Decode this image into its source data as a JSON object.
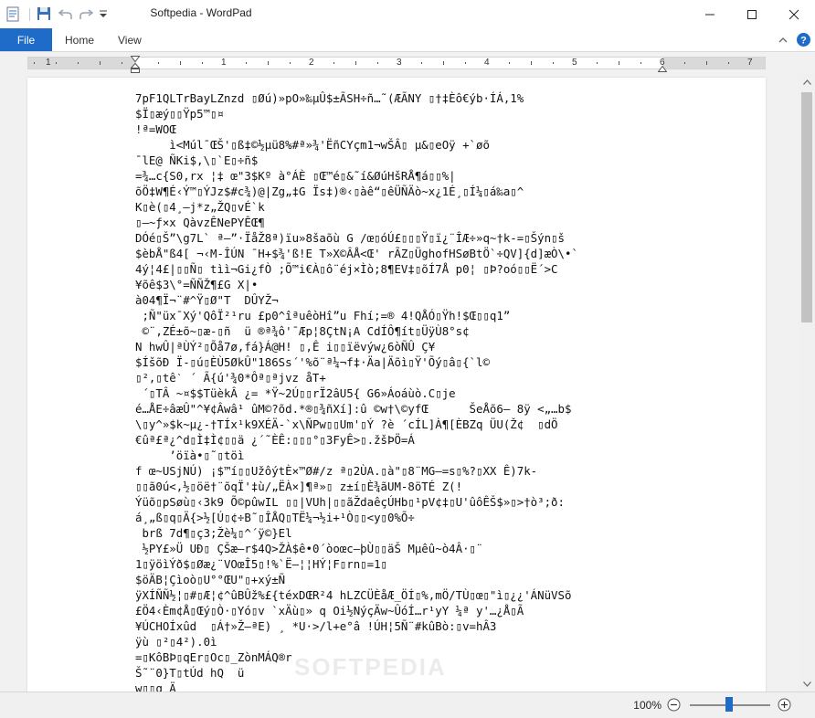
{
  "window": {
    "title": "Softpedia - WordPad",
    "minimize_symbol": "—",
    "maximize_symbol": "☐",
    "close_symbol": "✕"
  },
  "ribbon": {
    "tabs": [
      {
        "label": "File"
      },
      {
        "label": "Home"
      },
      {
        "label": "View"
      }
    ]
  },
  "ruler": {
    "numbers": [
      "1",
      "1",
      "2",
      "3",
      "4",
      "5",
      "6",
      "7"
    ]
  },
  "document": {
    "lines": [
      "7pF1QLTrBayLZnzd ▯Øú)»pO»‰µÛ$±ÃSH÷ñ…˜(ÆÃNY ▯†‡Èô€ýb·ÍÁ,1%",
      "$Ï▯æý▯▯Ÿp5™▯¤",
      "!ª=WOŒ",
      "     ì<Múl¯ŒŠ'▯ß‡©½µü8%#ª»¾'ËñCYçm1¬wŠÂ▯ µ&▯eOÿ +`øõ",
      "¯lE@ ÑKi$,\\▯`E▯÷ñ$",
      "=¾…c{S0,rx ¦‡ œ\"3$Kº à°ÁÈ ▯Œ™é▯&˜í&ØúHšRÅ¶á▯▯%|",
      "õÖ‡W¶É‹Ý™▯ÝJz$#c¾)@|Zg„‡G Ïs‡)®‹▯àê“▯êÜÑÄò~x¿1É¸▯Í¼▯á‰a▯^",
      "K▯è(▯4¸–j*z„ŽQ▯vÉ`k",
      "▯–~ƒ×x QàvzÊNePYÊŒ¶",
      "DÓé▯Š”\\g7L` ª–”·ÏåŽ8ª)ïu»8šaõù G /œ▯óÚ£▯▯▯Ÿ▯ï¿¨ÎÆ÷»q~†k-=▯Šýn▯š",
      "$èbÅ\"ß4[ ¬‹M-ÎÚN ¯H+$¾'ß!E T»X©ÂÅ<Œ' rÃZ▯ÜghofHSøBtÖ`÷QV]{d]æÒ\\•`",
      "4ý¦4£|▯▯Ñ▯ tìì¬Gi¿fÒ ;Õ™i€À▯ô¨éj×Ìò;8¶EV‡▯õÍ7Å p0¦ ▯Þ?oó▯▯Ë´>C",
      "¥õê$3\\°=ÑÑŽ¶£G X|•",
      "à04¶Ï¬¨#^Ÿ▯Ø\"T  DÛYŽ¬",
      " ;Ñ\"üx¯Xý'QôÏ²¹ru £p0^îªuêòHî”u Fhí;=® 4!QÅÓ▯Ÿh!$Œ▯▯q1”",
      " ©¨,ZÉ±õ~▯æ-▯ñ  ü ®ª¾ô'¯Æp¦8ÇtN¡A CdÍÔ¶ít▯ÜÿÙ8°s¢",
      "N hwÛ|ªÙÝ²▯Õå7ø,fá}Á@H! ▯,Ê i▯▯ïëvýw¿6òÑÛ Ç¥",
      "$ÍšõÐ Ï-▯ú▯ÈÙ5ØkÛ\"186Ss´'%õ¨ª¼¬f‡·Äa|Äõì▯Ÿ'Õý▯â▯{`l©",
      "▯²,▯têˋ ´ Ã{ú'¾0*Ôª▯ªjvz åT+",
      " ´▯TÂ ~¤$$TüèkÂ ¿= *Ÿ~2Ú▯▯rÏ2âU5{ G6»Áoáùò.C▯je",
      "é…ÅE÷âæÛ\"^¥¢Âwâ¹ ûM©?õd.*®▯¾ñXí]:û ©w†\\©yfŒ      ŠeÅõ6— 8ÿ <„…b$",
      "\\▯y^»$k~µ¿-†TÍx¹k9XÉÄ-`x\\ÑPw▯▯Um'▯Ý ?è ´cÍL]À¶[ÈBZq ÜU(Ž¢  ▯dÖ",
      "€ûª£ª¿^d▯Ì‡Ì¢▯▯ä ¿´˜ÈÊ:▯▯▯°▯3FyÊ>▯.žšÞÖ=Á",
      "     ’öïà•▯˜▯töì",
      "f œ~USjNÚ) ¡$™í▯▯UžôýtÈ×™Ø#/z ª▯2ÙA.▯à\"▯8¨MG–=s▯%?▯XX Ê)7k-",
      "▯▯ã0ú<,½▯öë†¨õqÏ'‡ù/„ËÀ×]¶ª»▯ z±í▯È¾ãUM-8öTÉ Z(!",
      "Ýüõ▯pSøù▯‹3k9 Õ©pûwIL ▯▯|VUh|▯▯ãŽdaêçÚHb▯¹pV¢‡▯U'ûôÊŠ$»▯>†ò³;ð:",
      "á¸„ß▯q▯Ä{>½[Ú▯¢÷B˜▯ÎÅQ▯TË¼¬½i+¹Ò▯▯<y▯0%Õ÷",
      " brß 7d¶▯ç3;Žè¼▯^´ÿ©}El",
      " ½PY£»Ü UÐ▯ ÇŠæ–r$4Q>ŽÀ$ê•0´òoœc—þÙ▯▯äŠ Mµêû~ò4Â·▯¨",
      "1▯ÿöìÝð$▯Øæ¿¨VOœÎ5▯!%`Ë–¦¦HÝ¦F▯rn▯=1▯",
      "$öÄB¦Çìoò▯U°°ŒU\"▯+xý±Ñ",
      "ÿXÍÑÑ½¦▯#▯Æ¦¢^ûBÛž%£{téxDŒR²4 hLZCÜÈåÆ_ÖÍ▯%,mÖ/TÙ▯œ▯\"ì▯¿¿'ÁNüVSõ",
      "£Ö4‹Èm¢Å▯Œý▯Ò·▯Yó▯v `xÄù▯» q Oi½NýçÄw~ÛóÍ…r¹yY ¼ª y'…¿Å▯Ã",
      "¥ÚCHOÍxûd  ▯Á†»Ž–ªE) ¸ *U·>/l+e°â !ÚH¦5Ñ¨#kûBò:▯v=hÂ3",
      "ÿù ▯²▯4²).0ì",
      "=▯KôBÞ▯qEr▯Oc▯_ZònMÁQ®r",
      "Š˜¨0}T▯tÚd hQ  ü",
      "w▯▯q Ä"
    ]
  },
  "watermark": "SOFTPEDIA",
  "statusbar": {
    "zoom_label": "100%",
    "zoom_value_percent": 100
  }
}
